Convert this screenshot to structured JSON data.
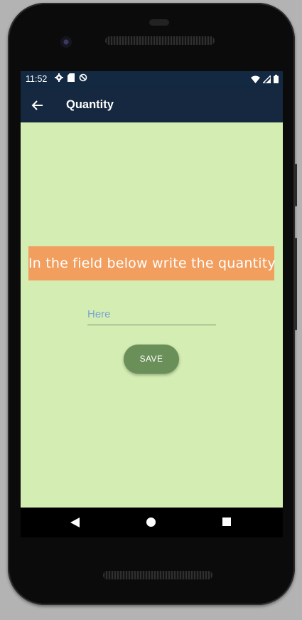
{
  "status_bar": {
    "time": "11:52",
    "left_icons": [
      "gear-icon",
      "sd-card-icon",
      "no-sync-icon"
    ],
    "right_icons": [
      "wifi-icon",
      "signal-icon",
      "battery-icon"
    ]
  },
  "app_bar": {
    "title": "Quantity",
    "back_icon": "arrow-back-icon"
  },
  "content": {
    "instruction": "In the field below write the quantity",
    "quantity_input": {
      "value": "",
      "placeholder": "Here"
    },
    "save_button": "SAVE"
  },
  "nav_bar": {
    "items": [
      "back-triangle-icon",
      "home-circle-icon",
      "recents-square-icon"
    ]
  },
  "colors": {
    "status_bar": "#132942",
    "app_bar": "#15283f",
    "content_background": "#d4edb3",
    "instruction_background": "#f29e5e",
    "save_button": "#6a8f59",
    "placeholder": "#7aa4cf"
  }
}
